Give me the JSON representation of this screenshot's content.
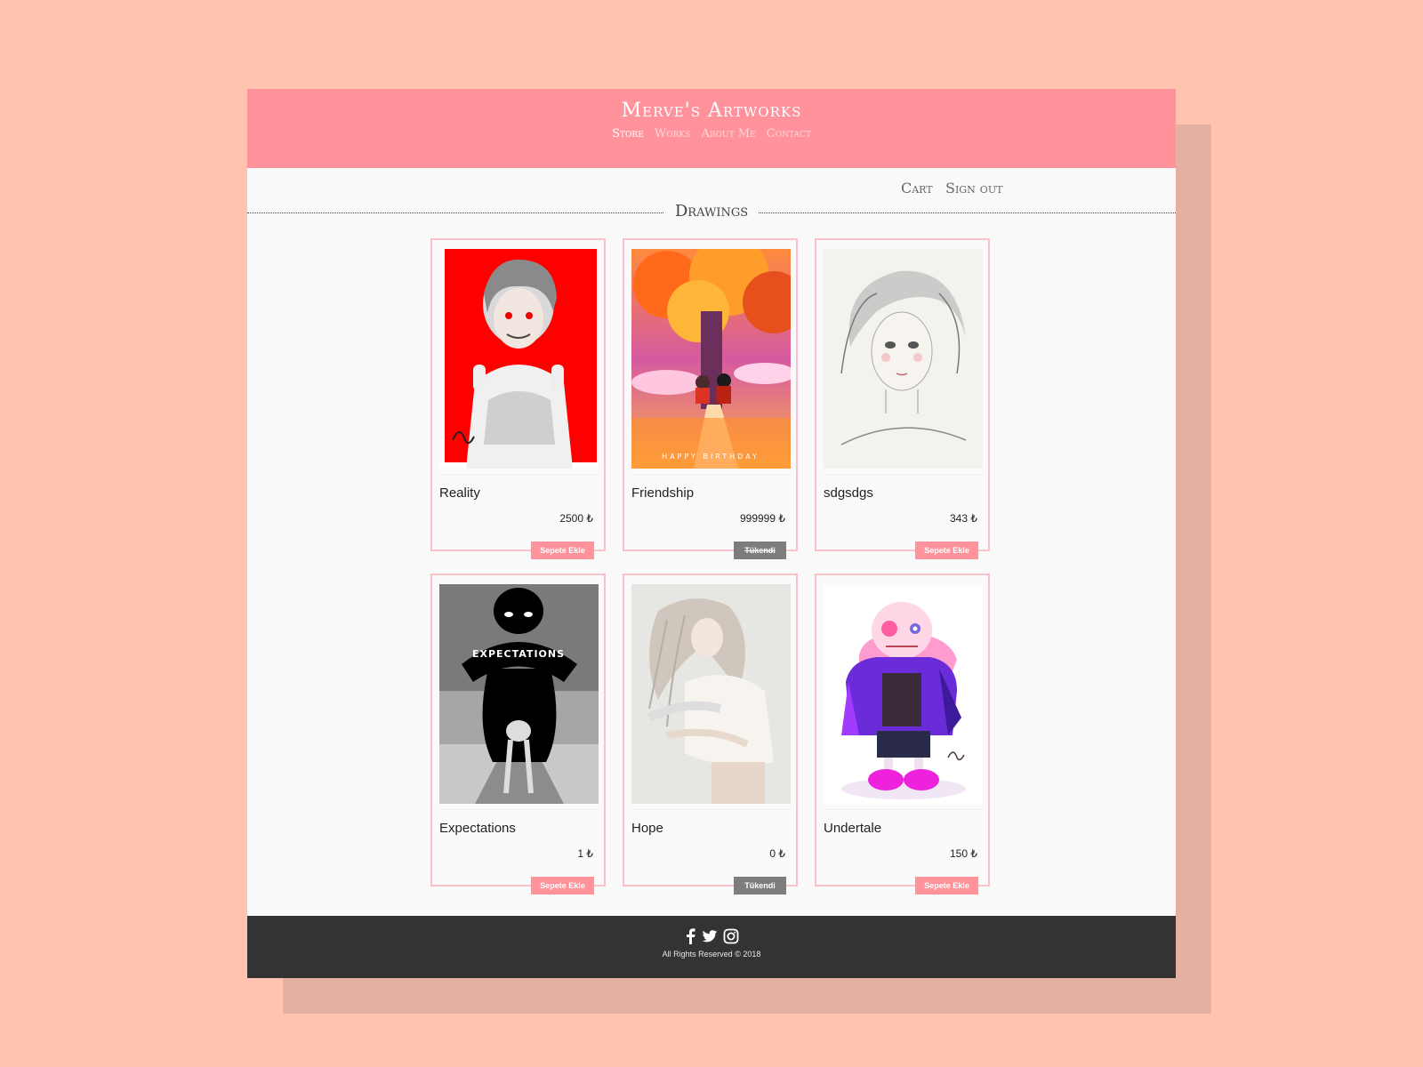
{
  "header": {
    "title": "Merve's Artworks",
    "nav": [
      {
        "label": "Store"
      },
      {
        "label": "Works"
      },
      {
        "label": "About Me"
      },
      {
        "label": "Contact"
      }
    ]
  },
  "userbar": {
    "cart": "Cart",
    "signout": "Sign out"
  },
  "section": {
    "title": "Drawings"
  },
  "products": [
    {
      "name": "Reality",
      "price": "2500 ₺",
      "button": "Sepete Ekle",
      "status": "available"
    },
    {
      "name": "Friendship",
      "price": "999999 ₺",
      "button": "Tükendi",
      "status": "sold-out"
    },
    {
      "name": "sdgsdgs",
      "price": "343 ₺",
      "button": "Sepete Ekle",
      "status": "available"
    },
    {
      "name": "Expectations",
      "price": "1 ₺",
      "button": "Sepete Ekle",
      "status": "available"
    },
    {
      "name": "Hope",
      "price": "0 ₺",
      "button": "Tükendi",
      "status": "sold-out"
    },
    {
      "name": "Undertale",
      "price": "150 ₺",
      "button": "Sepete Ekle",
      "status": "available"
    }
  ],
  "art_texts": {
    "friendship_caption": "HAPPY BIRTHDAY",
    "expectations_word": "EXPECTATIONS"
  },
  "footer": {
    "copyright": "All Rights Reserved © 2018",
    "social_icons": [
      "facebook-icon",
      "twitter-icon",
      "instagram-icon"
    ]
  },
  "colors": {
    "background": "#ffc3b0",
    "header": "#ff929b",
    "add_button": "#ff929b",
    "sold_button": "#7d7d7d",
    "footer": "#333333"
  }
}
